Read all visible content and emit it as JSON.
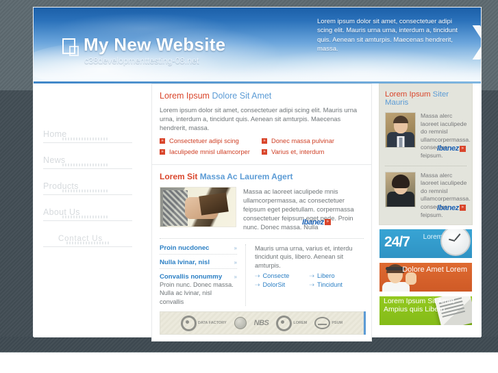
{
  "header": {
    "logo_icon": "overlapping-squares-icon",
    "site_title": "My New Website",
    "site_domain": "c38developmenttesting-08.net",
    "promo_text": "Lorem ipsum dolor sit amet, consectetuer adipi scing elit. Mauris urna urna, interdum a, tincidunt quis. Aenean sit amturpis. Maecenas hendrerit, massa.",
    "brace_glyph": "❯"
  },
  "nav": {
    "items": [
      {
        "label": "Home"
      },
      {
        "label": "News"
      },
      {
        "label": "Products"
      },
      {
        "label": "About Us"
      },
      {
        "label": "Contact Us"
      }
    ]
  },
  "main": {
    "article1": {
      "title_a": "Lorem Ipsum",
      "title_b": "Dolore Sit Amet",
      "body": "Lorem ipsum dolor sit amet, consectetuer adipi scing elit. Mauris urna urna, interdum a, tincidunt quis. Aenean sit amturpis. Maecenas hendrerit, massa.",
      "bullet_glyph": "»",
      "links": [
        "Consectetuer adipi scing",
        "Donec massa pulvinar",
        "Iaculipede mnisl ullamcorper",
        "Varius et, interdum"
      ]
    },
    "article2": {
      "title_a": "Lorem Sit",
      "title_b": "Massa Ac Laurem Agert",
      "thumb_name": "hands-holding-wallet-photo",
      "body": "Massa ac laoreet iaculipede mnis ullamcorpermassa, ac consectetuer feipsum eget pedetullam. corpermassa consectetuer feipsum eget pede. Proin nunc. Donec massa. Nulla",
      "watermark": "Ibanez",
      "watermark_chip": "»"
    },
    "left_list": {
      "arrow_glyph": "»",
      "items": [
        "Proin nucdonec",
        "Nulla lvinar, nisl",
        "Convallis nonummy"
      ],
      "body": "Proin nunc. Donec massa. Nulla ac lvinar, nisl convallis"
    },
    "right_block": {
      "body": "Mauris urna urna, varius et, interdu tincidunt quis, libero. Aenean sit amturpis.",
      "arrow_glyph": "⇢",
      "links": [
        "Consecte",
        "Libero",
        "DolorSit",
        "Tincidunt"
      ]
    },
    "partners": {
      "logos": [
        {
          "name": "data-factory-logo",
          "label": "DATA\nFACTORY"
        },
        {
          "name": "globe-logo",
          "label": ""
        },
        {
          "name": "nbs-logo",
          "label": "NBS"
        },
        {
          "name": "circle-dot-logo",
          "label": "LOREM"
        },
        {
          "name": "ipsum-logo",
          "label": "PSUM"
        }
      ]
    }
  },
  "rail": {
    "title_a": "Lorem Ipsum",
    "title_b": "Siter Mauris",
    "people": [
      {
        "photo_name": "businessman-portrait-photo",
        "body": "Massa alerc laoreet iaculipede do remnisl ullamcorpermassa. consectuer feipsum.",
        "watermark": "Ibanez",
        "watermark_chip": "»"
      },
      {
        "photo_name": "woman-portrait-photo",
        "body": "Massa alerc laoreet iaculipede do remnisl ullamcorpermassa. consectuer feipsum.",
        "watermark": "Ibanez",
        "watermark_chip": "»"
      }
    ],
    "banners": [
      {
        "name": "banner-24-7",
        "big": "24/7",
        "lines": "Lorem Ipsum Dolore",
        "icon": "wall-clock-icon",
        "color": "#32a0d0"
      },
      {
        "name": "banner-support",
        "lines": "Dolore Amet Lorem",
        "icon": "headset-operator-photo",
        "color": "#d8642c"
      },
      {
        "name": "banner-news",
        "lines": "Lorem Ipsum Sit Amet Ampius quis Libero",
        "icon": "newspaper-icon",
        "color": "#8dc41d"
      }
    ]
  }
}
